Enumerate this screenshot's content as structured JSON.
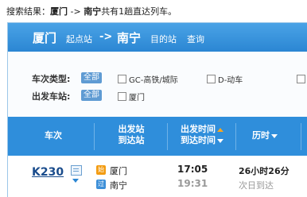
{
  "summary": {
    "prefix": "搜索结果：",
    "from": "厦门",
    "arrow": "->",
    "to": "南宁",
    "suffix": "共有1趟直达列车。"
  },
  "route": {
    "from": "厦门",
    "from_tag": "起点站",
    "arrow": "->",
    "to": "南宁",
    "to_tag": "目的站",
    "query": "查询"
  },
  "filters": {
    "type_label": "车次类型:",
    "type_all": "全部",
    "type_options": [
      "GC-高铁/城际",
      "D-动车"
    ],
    "station_label": "出发车站:",
    "station_all": "全部",
    "station_options": [
      "厦门"
    ]
  },
  "table": {
    "headers": {
      "train": "车次",
      "station_1": "出发站",
      "station_2": "到达站",
      "time_1": "出发时间",
      "time_2": "到达时间",
      "duration": "历时"
    },
    "rows": [
      {
        "train_no": "K230",
        "depart_badge": "始",
        "arrive_badge": "过",
        "depart_station": "厦门",
        "arrive_station": "南宁",
        "depart_time": "17:05",
        "arrive_time": "19:31",
        "duration": "26小时26分",
        "arrival_day": "次日到达"
      }
    ]
  },
  "colors": {
    "header_blue": "#2f8edb",
    "start_badge": "#f39c12",
    "pass_badge": "#3d8fd8"
  }
}
